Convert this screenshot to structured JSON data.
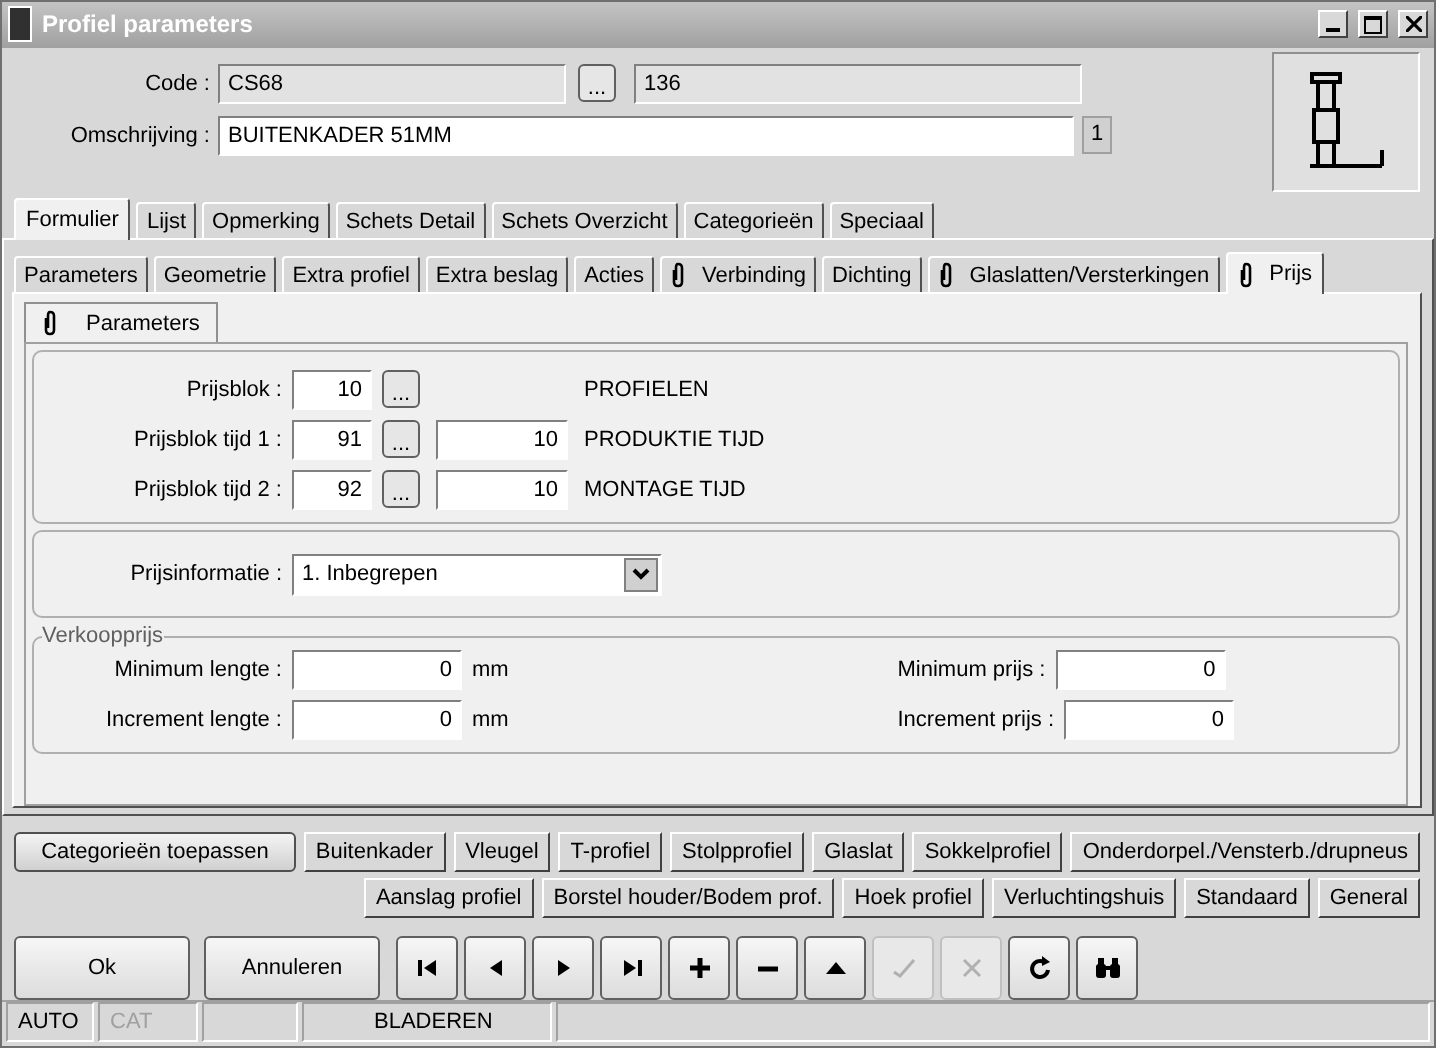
{
  "window": {
    "title": "Profiel parameters"
  },
  "header": {
    "code_label": "Code :",
    "code": "CS68",
    "code_lookup": "...",
    "code_number": "136",
    "description_label": "Omschrijving :",
    "description": "BUITENKADER 51MM",
    "description_index": "1"
  },
  "main_tabs": [
    {
      "label": "Formulier",
      "selected": true
    },
    {
      "label": "Lijst",
      "selected": false
    },
    {
      "label": "Opmerking",
      "selected": false
    },
    {
      "label": "Schets Detail",
      "selected": false
    },
    {
      "label": "Schets Overzicht",
      "selected": false
    },
    {
      "label": "Categorieën",
      "selected": false
    },
    {
      "label": "Speciaal",
      "selected": false
    }
  ],
  "sub_tabs": [
    {
      "label": "Parameters",
      "selected": false,
      "attachment": false
    },
    {
      "label": "Geometrie",
      "selected": false,
      "attachment": false
    },
    {
      "label": "Extra profiel",
      "selected": false,
      "attachment": false
    },
    {
      "label": "Extra beslag",
      "selected": false,
      "attachment": false
    },
    {
      "label": "Acties",
      "selected": false,
      "attachment": false
    },
    {
      "label": "Verbinding",
      "selected": false,
      "attachment": true
    },
    {
      "label": "Dichting",
      "selected": false,
      "attachment": false
    },
    {
      "label": "Glaslatten/Versterkingen",
      "selected": false,
      "attachment": true
    },
    {
      "label": "Prijs",
      "selected": true,
      "attachment": true
    }
  ],
  "inner_tab": {
    "label": "Parameters",
    "attachment": true
  },
  "price_blocks": [
    {
      "label": "Prijsblok :",
      "value": "10",
      "lookup": "...",
      "description": "PROFIELEN"
    },
    {
      "label": "Prijsblok tijd 1 :",
      "value": "91",
      "lookup": "...",
      "time": "10",
      "description": "PRODUKTIE TIJD"
    },
    {
      "label": "Prijsblok tijd 2 :",
      "value": "92",
      "lookup": "...",
      "time": "10",
      "description": "MONTAGE TIJD"
    }
  ],
  "price_info": {
    "label": "Prijsinformatie :",
    "value": "1.  Inbegrepen"
  },
  "sales_price": {
    "title": "Verkoopprijs",
    "left_fields": [
      {
        "label": "Minimum lengte :",
        "value": "0",
        "unit": "mm"
      },
      {
        "label": "Increment lengte :",
        "value": "0",
        "unit": "mm"
      }
    ],
    "right_fields": [
      {
        "label": "Minimum prijs :",
        "value": "0"
      },
      {
        "label": "Increment prijs :",
        "value": "0"
      }
    ]
  },
  "category_rows": [
    {
      "buttons": [
        {
          "label": "Categorieën toepassen",
          "kind": "apply"
        },
        {
          "label": "Buitenkader",
          "kind": "category"
        },
        {
          "label": "Vleugel",
          "kind": "category"
        },
        {
          "label": "T-profiel",
          "kind": "category"
        },
        {
          "label": "Stolpprofiel",
          "kind": "category"
        },
        {
          "label": "Glaslat",
          "kind": "category"
        },
        {
          "label": "Sokkelprofiel",
          "kind": "category"
        },
        {
          "label": "Onderdorpel./Vensterb./drupneus",
          "kind": "category"
        }
      ]
    },
    {
      "buttons": [
        {
          "label": "Aanslag profiel",
          "kind": "category"
        },
        {
          "label": "Borstel houder/Bodem prof.",
          "kind": "category"
        },
        {
          "label": "Hoek profiel",
          "kind": "category"
        },
        {
          "label": "Verluchtingshuis",
          "kind": "category"
        },
        {
          "label": "Standaard",
          "kind": "category"
        },
        {
          "label": "General",
          "kind": "category"
        }
      ]
    }
  ],
  "actions": [
    {
      "label": "Ok"
    },
    {
      "label": "Annuleren"
    }
  ],
  "nav_buttons": [
    {
      "kind": "first",
      "disabled": false
    },
    {
      "kind": "previous",
      "disabled": false
    },
    {
      "kind": "next",
      "disabled": false
    },
    {
      "kind": "last",
      "disabled": false
    },
    {
      "kind": "add",
      "disabled": false
    },
    {
      "kind": "remove",
      "disabled": false
    },
    {
      "kind": "up",
      "disabled": false
    },
    {
      "kind": "confirm",
      "disabled": true
    },
    {
      "kind": "cancel",
      "disabled": true
    },
    {
      "kind": "refresh",
      "disabled": false
    },
    {
      "kind": "find",
      "disabled": false
    }
  ],
  "status_bar": [
    {
      "kind": "text",
      "text": "AUTO",
      "disabled": false
    },
    {
      "kind": "text",
      "text": "CAT",
      "disabled": true
    },
    {
      "kind": "blank"
    },
    {
      "kind": "text",
      "text": "BLADEREN",
      "disabled": false
    },
    {
      "kind": "blank"
    }
  ]
}
